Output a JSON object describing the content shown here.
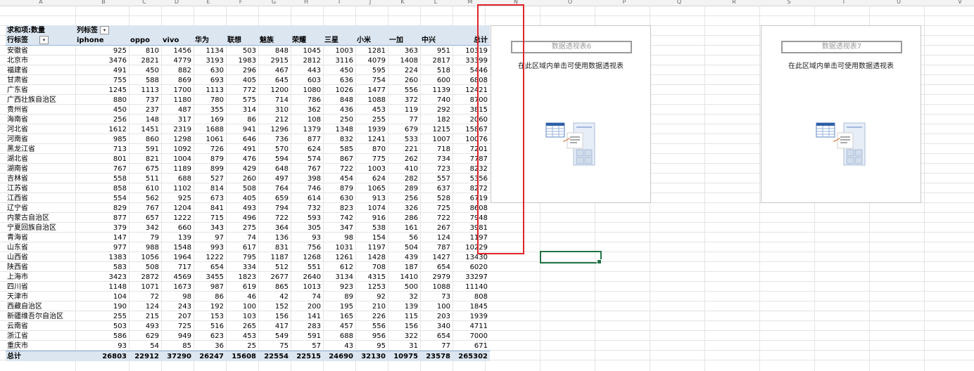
{
  "columns": [
    "A",
    "B",
    "C",
    "D",
    "E",
    "F",
    "G",
    "H",
    "I",
    "J",
    "K",
    "L",
    "M",
    "N",
    "O",
    "P",
    "Q",
    "R",
    "S",
    "T",
    "U",
    "V"
  ],
  "pivot": {
    "corner_label": "求和项:数量",
    "col_label": "列标签",
    "row_label": "行标签",
    "filter_glyph": "▾",
    "brands": [
      "iphone",
      "oppo",
      "vivo",
      "华为",
      "联想",
      "魅族",
      "荣耀",
      "三星",
      "小米",
      "一加",
      "中兴",
      "总计"
    ],
    "rows": [
      {
        "name": "安徽省",
        "values": [
          "925",
          "810",
          "1456",
          "1134",
          "503",
          "848",
          "1045",
          "1003",
          "1281",
          "363",
          "951",
          "10319"
        ]
      },
      {
        "name": "北京市",
        "values": [
          "3476",
          "2821",
          "4779",
          "3193",
          "1983",
          "2915",
          "2812",
          "3116",
          "4079",
          "1408",
          "2817",
          "33399"
        ]
      },
      {
        "name": "福建省",
        "values": [
          "491",
          "450",
          "882",
          "630",
          "296",
          "467",
          "443",
          "450",
          "595",
          "224",
          "518",
          "5446"
        ]
      },
      {
        "name": "甘肃省",
        "values": [
          "755",
          "588",
          "869",
          "693",
          "405",
          "645",
          "603",
          "636",
          "754",
          "260",
          "600",
          "6808"
        ]
      },
      {
        "name": "广东省",
        "values": [
          "1245",
          "1113",
          "1700",
          "1113",
          "772",
          "1200",
          "1080",
          "1026",
          "1477",
          "556",
          "1139",
          "12421"
        ]
      },
      {
        "name": "广西壮族自治区",
        "values": [
          "880",
          "737",
          "1180",
          "780",
          "575",
          "714",
          "786",
          "848",
          "1088",
          "372",
          "740",
          "8700"
        ]
      },
      {
        "name": "贵州省",
        "values": [
          "450",
          "237",
          "487",
          "355",
          "314",
          "310",
          "362",
          "436",
          "453",
          "119",
          "292",
          "3815"
        ]
      },
      {
        "name": "海南省",
        "values": [
          "256",
          "148",
          "317",
          "169",
          "86",
          "212",
          "108",
          "250",
          "255",
          "77",
          "182",
          "2060"
        ]
      },
      {
        "name": "河北省",
        "values": [
          "1612",
          "1451",
          "2319",
          "1688",
          "941",
          "1296",
          "1379",
          "1348",
          "1939",
          "679",
          "1215",
          "15867"
        ]
      },
      {
        "name": "河南省",
        "values": [
          "985",
          "860",
          "1298",
          "1061",
          "646",
          "736",
          "877",
          "832",
          "1241",
          "533",
          "1007",
          "10076"
        ]
      },
      {
        "name": "黑龙江省",
        "values": [
          "713",
          "591",
          "1092",
          "726",
          "491",
          "570",
          "624",
          "585",
          "870",
          "221",
          "718",
          "7201"
        ]
      },
      {
        "name": "湖北省",
        "values": [
          "801",
          "821",
          "1004",
          "879",
          "476",
          "594",
          "574",
          "867",
          "775",
          "262",
          "734",
          "7787"
        ]
      },
      {
        "name": "湖南省",
        "values": [
          "767",
          "675",
          "1189",
          "899",
          "429",
          "648",
          "767",
          "722",
          "1003",
          "410",
          "723",
          "8232"
        ]
      },
      {
        "name": "吉林省",
        "values": [
          "558",
          "511",
          "688",
          "527",
          "260",
          "497",
          "398",
          "454",
          "624",
          "282",
          "557",
          "5356"
        ]
      },
      {
        "name": "江苏省",
        "values": [
          "858",
          "610",
          "1102",
          "814",
          "508",
          "764",
          "746",
          "879",
          "1065",
          "289",
          "637",
          "8272"
        ]
      },
      {
        "name": "江西省",
        "values": [
          "554",
          "562",
          "925",
          "673",
          "405",
          "659",
          "614",
          "630",
          "913",
          "256",
          "528",
          "6719"
        ]
      },
      {
        "name": "辽宁省",
        "values": [
          "829",
          "767",
          "1204",
          "841",
          "493",
          "794",
          "732",
          "823",
          "1074",
          "326",
          "725",
          "8608"
        ]
      },
      {
        "name": "内蒙古自治区",
        "values": [
          "877",
          "657",
          "1222",
          "715",
          "496",
          "722",
          "593",
          "742",
          "916",
          "286",
          "722",
          "7948"
        ]
      },
      {
        "name": "宁夏回族自治区",
        "values": [
          "379",
          "342",
          "660",
          "343",
          "275",
          "364",
          "305",
          "347",
          "538",
          "161",
          "267",
          "3981"
        ]
      },
      {
        "name": "青海省",
        "values": [
          "147",
          "79",
          "139",
          "97",
          "74",
          "136",
          "93",
          "98",
          "154",
          "56",
          "124",
          "1197"
        ]
      },
      {
        "name": "山东省",
        "values": [
          "977",
          "988",
          "1548",
          "993",
          "617",
          "831",
          "756",
          "1031",
          "1197",
          "504",
          "787",
          "10229"
        ]
      },
      {
        "name": "山西省",
        "values": [
          "1383",
          "1056",
          "1964",
          "1222",
          "795",
          "1187",
          "1268",
          "1261",
          "1428",
          "439",
          "1427",
          "13430"
        ]
      },
      {
        "name": "陕西省",
        "values": [
          "583",
          "508",
          "717",
          "654",
          "334",
          "512",
          "551",
          "612",
          "708",
          "187",
          "654",
          "6020"
        ]
      },
      {
        "name": "上海市",
        "values": [
          "3423",
          "2872",
          "4569",
          "3455",
          "1823",
          "2677",
          "2640",
          "3134",
          "4315",
          "1410",
          "2979",
          "33297"
        ]
      },
      {
        "name": "四川省",
        "values": [
          "1148",
          "1071",
          "1673",
          "987",
          "619",
          "865",
          "1013",
          "923",
          "1253",
          "500",
          "1088",
          "11140"
        ]
      },
      {
        "name": "天津市",
        "values": [
          "104",
          "72",
          "98",
          "86",
          "46",
          "42",
          "74",
          "89",
          "92",
          "32",
          "73",
          "808"
        ]
      },
      {
        "name": "西藏自治区",
        "values": [
          "190",
          "124",
          "243",
          "192",
          "100",
          "152",
          "200",
          "195",
          "210",
          "139",
          "100",
          "1845"
        ]
      },
      {
        "name": "新疆维吾尔自治区",
        "values": [
          "255",
          "215",
          "207",
          "153",
          "103",
          "156",
          "141",
          "165",
          "226",
          "115",
          "203",
          "1939"
        ]
      },
      {
        "name": "云南省",
        "values": [
          "503",
          "493",
          "725",
          "516",
          "265",
          "417",
          "283",
          "457",
          "556",
          "156",
          "340",
          "4711"
        ]
      },
      {
        "name": "浙江省",
        "values": [
          "586",
          "629",
          "949",
          "623",
          "453",
          "549",
          "591",
          "688",
          "956",
          "322",
          "654",
          "7000"
        ]
      },
      {
        "name": "重庆市",
        "values": [
          "93",
          "54",
          "85",
          "36",
          "25",
          "75",
          "57",
          "43",
          "95",
          "31",
          "77",
          "671"
        ]
      }
    ],
    "total_label": "总计",
    "totals": [
      "26803",
      "22912",
      "37290",
      "26247",
      "15608",
      "22554",
      "22515",
      "24690",
      "32130",
      "10975",
      "23578",
      "265302"
    ]
  },
  "placeholders": [
    {
      "title": "数据透视表6",
      "message": "在此区域内单击可使用数据透视表"
    },
    {
      "title": "数据透视表7",
      "message": "在此区域内单击可使用数据透视表"
    }
  ],
  "colors": {
    "header_bg": "#dce6f1",
    "highlight": "#e2242a",
    "selection": "#217346"
  }
}
